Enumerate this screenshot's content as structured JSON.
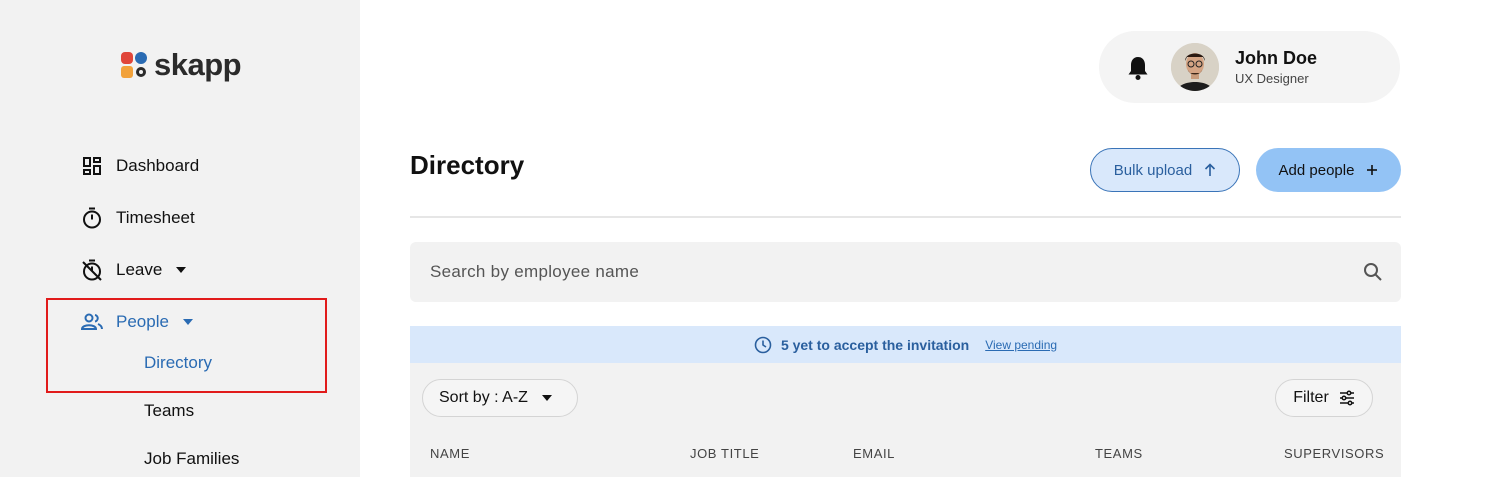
{
  "app": {
    "name": "skapp",
    "brand_color": "#2a6bb3",
    "highlight_color": "#e11b1b"
  },
  "sidebar": {
    "items": [
      {
        "label": "Dashboard",
        "icon": "dashboard-icon"
      },
      {
        "label": "Timesheet",
        "icon": "stopwatch-icon"
      },
      {
        "label": "Leave",
        "icon": "leave-timer-icon",
        "expandable": true
      },
      {
        "label": "People",
        "icon": "people-icon",
        "expandable": true,
        "active": true
      }
    ],
    "people_subitems": [
      {
        "label": "Directory",
        "active": true
      },
      {
        "label": "Teams"
      },
      {
        "label": "Job Families"
      }
    ]
  },
  "profile": {
    "name": "John Doe",
    "role": "UX Designer"
  },
  "main": {
    "title": "Directory",
    "bulk_upload_label": "Bulk upload",
    "add_people_label": "Add people",
    "search_placeholder": "Search by employee name",
    "banner": {
      "text": "5 yet to accept the invitation",
      "link": "View pending"
    },
    "sort_label": "Sort by : A-Z",
    "filter_label": "Filter",
    "columns": [
      "NAME",
      "JOB TITLE",
      "EMAIL",
      "TEAMS",
      "SUPERVISORS"
    ]
  }
}
